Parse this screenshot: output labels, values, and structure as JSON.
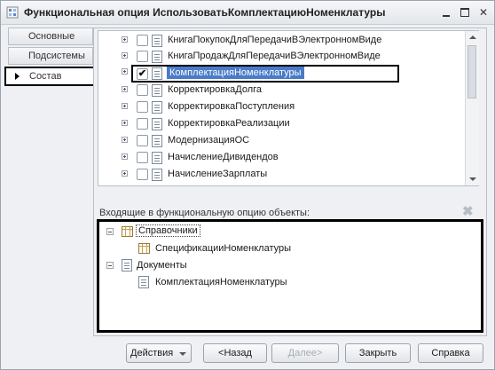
{
  "window": {
    "title": "Функциональная опция ИспользоватьКомплектациюНоменклатуры"
  },
  "tabs": [
    {
      "label": "Основные"
    },
    {
      "label": "Подсистемы"
    },
    {
      "label": "Состав"
    }
  ],
  "list": {
    "items": [
      {
        "label": "КнигаПокупокДляПередачиВЭлектронномВиде",
        "checked": false
      },
      {
        "label": "КнигаПродажДляПередачиВЭлектронномВиде",
        "checked": false
      },
      {
        "label": "КомплектацияНоменклатуры",
        "checked": true,
        "selected": true
      },
      {
        "label": "КорректировкаДолга",
        "checked": false
      },
      {
        "label": "КорректировкаПоступления",
        "checked": false
      },
      {
        "label": "КорректировкаРеализации",
        "checked": false
      },
      {
        "label": "МодернизацияОС",
        "checked": false
      },
      {
        "label": "НачислениеДивидендов",
        "checked": false
      },
      {
        "label": "НачислениеЗарплаты",
        "checked": false
      }
    ],
    "check_mark": "✔"
  },
  "incoming": {
    "label": "Входящие в функциональную опцию объекты:",
    "clear_icon": "✖",
    "groups": [
      {
        "label": "Справочники",
        "children": [
          {
            "label": "СпецификацииНоменклатуры"
          }
        ]
      },
      {
        "label": "Документы",
        "children": [
          {
            "label": "КомплектацияНоменклатуры"
          }
        ]
      }
    ]
  },
  "buttons": {
    "actions": "Действия",
    "back": "<Назад",
    "next": "Далее>",
    "close": "Закрыть",
    "help": "Справка"
  },
  "icons": {
    "window": "functional-option-icon",
    "minimize": "minimize-icon",
    "maximize": "maximize-icon",
    "close": "close-icon"
  }
}
